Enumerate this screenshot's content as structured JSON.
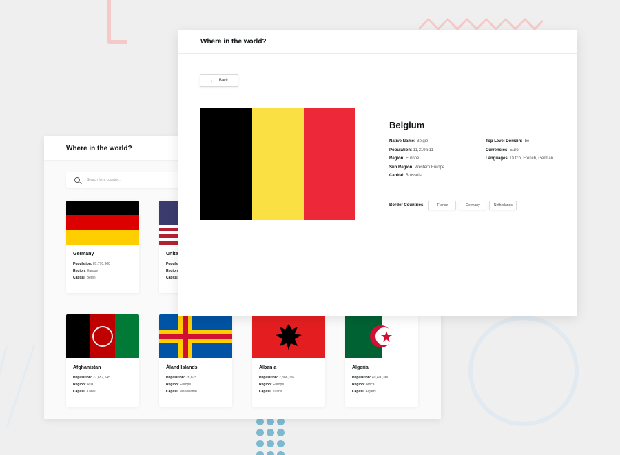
{
  "home": {
    "title": "Where in the world?",
    "search_placeholder": "Search for a country...",
    "cards": [
      {
        "name": "Germany",
        "population": "81,770,900",
        "region": "Europe",
        "capital": "Berlin"
      },
      {
        "name": "United States of America",
        "population": "",
        "region": "",
        "capital": ""
      },
      {
        "name": "Afghanistan",
        "population": "27,657,145",
        "region": "Asia",
        "capital": "Kabul"
      },
      {
        "name": "Åland Islands",
        "population": "28,875",
        "region": "Europe",
        "capital": "Mariehamn"
      },
      {
        "name": "Albania",
        "population": "2,886,026",
        "region": "Europe",
        "capital": "Tirana"
      },
      {
        "name": "Algeria",
        "population": "40,400,000",
        "region": "Africa",
        "capital": "Algiers"
      }
    ],
    "labels": {
      "population": "Population:",
      "region": "Region:",
      "capital": "Capital:"
    }
  },
  "detail": {
    "title": "Where in the world?",
    "back_label": "Back",
    "country": "Belgium",
    "left": [
      {
        "label": "Native Name:",
        "value": "België"
      },
      {
        "label": "Population:",
        "value": "11,319,511"
      },
      {
        "label": "Region:",
        "value": "Europe"
      },
      {
        "label": "Sub Region:",
        "value": "Western Europe"
      },
      {
        "label": "Capital:",
        "value": "Brussels"
      }
    ],
    "right": [
      {
        "label": "Top Level Domain:",
        "value": ".be"
      },
      {
        "label": "Currencies:",
        "value": "Euro"
      },
      {
        "label": "Languages:",
        "value": "Dutch, French, German"
      }
    ],
    "border_label": "Border Countries:",
    "borders": [
      "France",
      "Germany",
      "Netherlands"
    ]
  },
  "colors": {
    "background": "#efefef",
    "belgium_black": "#000000",
    "belgium_yellow": "#fae042",
    "belgium_red": "#ed2939"
  },
  "icons": [
    "search-icon",
    "arrow-left-icon"
  ]
}
